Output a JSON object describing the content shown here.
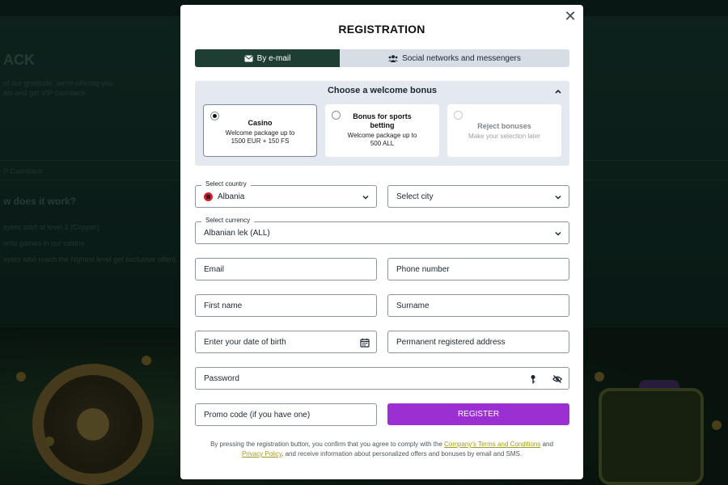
{
  "background": {
    "title": "ACK",
    "intro_line1": "of our gratitude, we're offering you",
    "intro_line2": "ain and get VIP cashback",
    "section": "P Cashback",
    "heading": "w does it work?",
    "line1": "ayers start at level 1 (Copper)",
    "line2": "orite games in our casino",
    "line3": "ayers who reach the highest level get exclusive offers. VIP c"
  },
  "modal": {
    "title": "REGISTRATION",
    "close_icon": "close-icon",
    "tabs": [
      {
        "label": "By e-mail",
        "icon": "envelope-icon",
        "active": true
      },
      {
        "label": "Social networks and messengers",
        "icon": "users-icon",
        "active": false
      }
    ],
    "bonus": {
      "heading": "Choose a welcome bonus",
      "options": [
        {
          "title": "Casino",
          "desc": "Welcome package up to 1500 EUR + 150 FS",
          "selected": true
        },
        {
          "title": "Bonus for sports betting",
          "desc": "Welcome package up to 500 ALL",
          "selected": false
        },
        {
          "title": "Reject bonuses",
          "desc": "Make your selection later",
          "selected": false
        }
      ]
    },
    "country": {
      "label": "Select country",
      "value": "Albania"
    },
    "city": {
      "placeholder": "Select city"
    },
    "currency": {
      "label": "Select currency",
      "value": "Albanian lek (ALL)"
    },
    "email": {
      "placeholder": "Email"
    },
    "phone": {
      "placeholder": "Phone number"
    },
    "first_name": {
      "placeholder": "First name"
    },
    "surname": {
      "placeholder": "Surname"
    },
    "dob": {
      "placeholder": "Enter your date of birth"
    },
    "address": {
      "placeholder": "Permanent registered address"
    },
    "password": {
      "placeholder": "Password"
    },
    "promo": {
      "placeholder": "Promo code (if you have one)"
    },
    "register_label": "REGISTER",
    "legal": {
      "part1": "By pressing the registration button, you confirm that you agree to comply with the ",
      "terms_link": "Company's Terms and Conditions",
      "part2": " and ",
      "privacy_link": "Privacy Policy",
      "part3": ", and receive information about personalized offers and bonuses by email and SMS."
    }
  },
  "colors": {
    "accent": "#9b2fd1",
    "tab_active": "#1e3d33",
    "link": "#a69a1d"
  }
}
